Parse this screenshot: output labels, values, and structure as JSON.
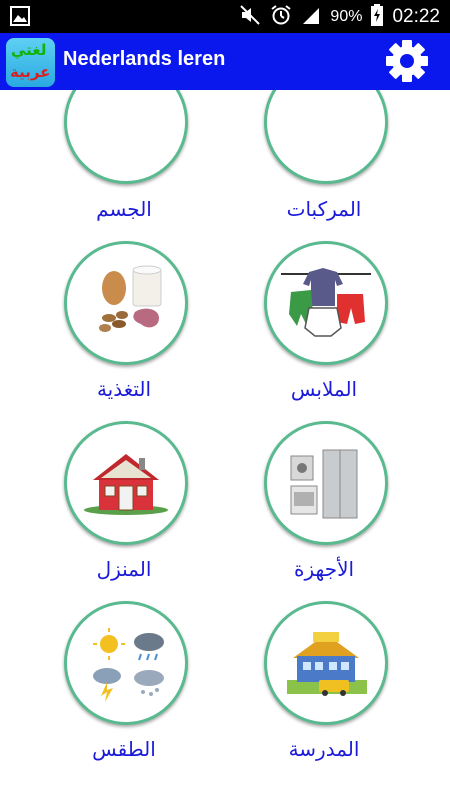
{
  "status_bar": {
    "battery_percent": "90%",
    "time": "02:22",
    "icons": [
      "image-icon",
      "mute-icon",
      "alarm-icon",
      "signal-icon",
      "battery-icon"
    ]
  },
  "app_bar": {
    "title": "Nederlands leren",
    "logo_text_top": "لغتي",
    "logo_text_bottom": "عربية",
    "settings_icon": "gear-icon"
  },
  "categories": [
    {
      "label": "المركبات",
      "icon": "vehicles-icon"
    },
    {
      "label": "الجسم",
      "icon": "body-icon"
    },
    {
      "label": "الملابس",
      "icon": "clothes-icon"
    },
    {
      "label": "التغذية",
      "icon": "food-icon"
    },
    {
      "label": "الأجهزة",
      "icon": "appliances-icon"
    },
    {
      "label": "المنزل",
      "icon": "house-icon"
    },
    {
      "label": "المدرسة",
      "icon": "school-icon"
    },
    {
      "label": "الطقس",
      "icon": "weather-icon"
    }
  ],
  "colors": {
    "app_bar": "#0a18ee",
    "label": "#1a1ad8",
    "circle_border": "#59b98f"
  }
}
